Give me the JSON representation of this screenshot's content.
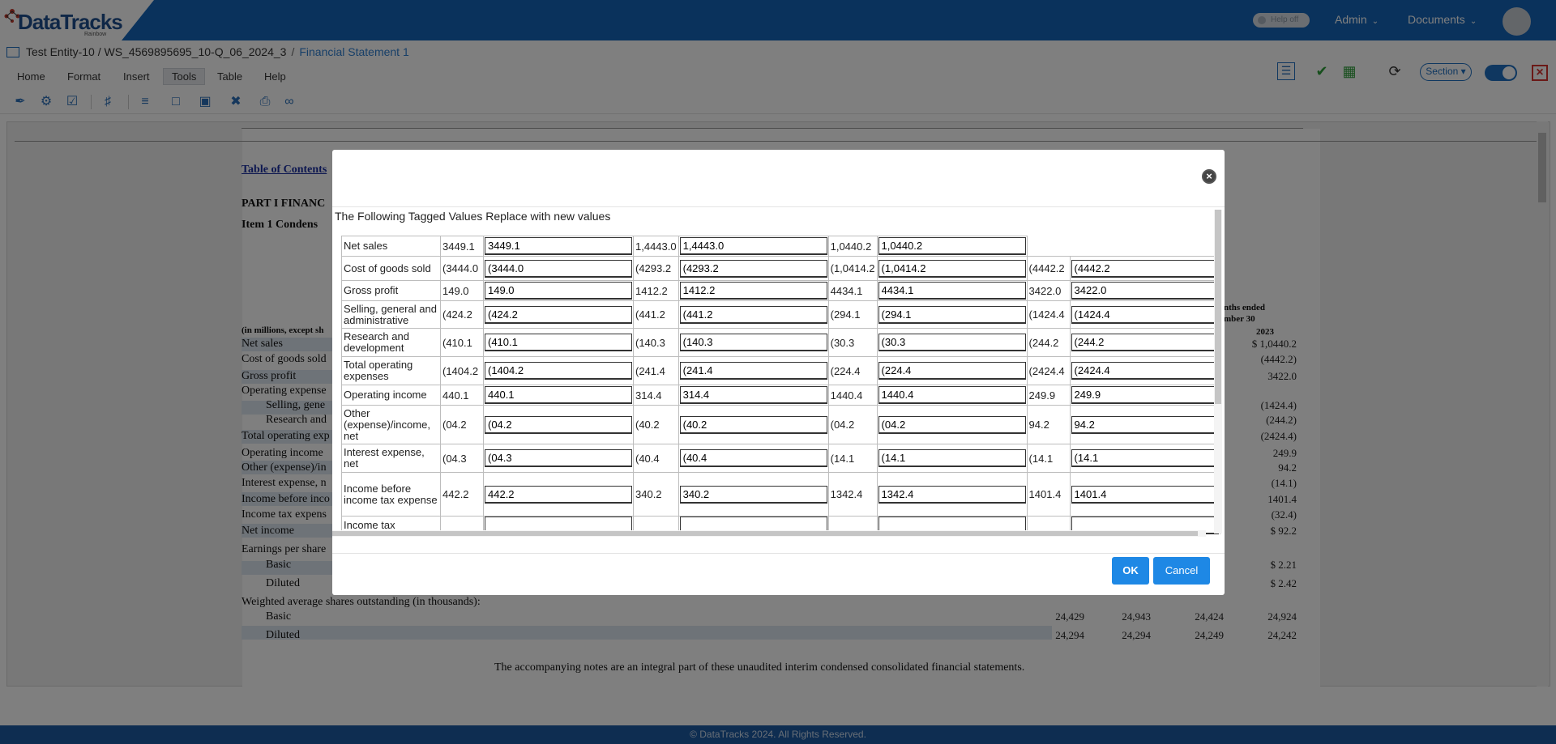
{
  "app": {
    "logo": "DataTracks",
    "logo_sub": "Rainbow",
    "help_toggle": "Help off",
    "menus": [
      "Admin",
      "Documents"
    ]
  },
  "breadcrumb": {
    "entity": "Test Entity-10 / WS_4569895695_10-Q_06_2024_3",
    "separator": "/",
    "current": "Financial Statement 1"
  },
  "menubar": [
    "Home",
    "Format",
    "Insert",
    "Tools",
    "Table",
    "Help"
  ],
  "menubar_selected": "Tools",
  "toolbar_right": {
    "section": "Section"
  },
  "document": {
    "toc_link": "Table of Contents",
    "part": "PART I    FINANC",
    "item": "Item 1    Condens",
    "units_label": "(in millions, except sh",
    "period_header": "nths ended",
    "period_header2": "mber 30",
    "year": "2023",
    "rows": [
      "Net sales",
      "Cost of goods sold",
      "Gross profit",
      "Operating expense",
      "Selling, gene",
      "Research and",
      "Total operating exp",
      "Operating income",
      "Other (expense)/in",
      "Interest expense, n",
      "Income before inco",
      "Income tax expens",
      "Net income",
      "Earnings per share",
      "Basic",
      "Diluted",
      "Weighted average shares outstanding (in thousands):",
      "Basic",
      "Diluted"
    ],
    "right_col": [
      "$ 1,0440.2",
      "(4442.2)",
      "3422.0",
      "",
      "(1424.4)",
      "(244.2)",
      "(2424.4)",
      "249.9",
      "94.2",
      "(14.1)",
      "1401.4",
      "(32.4)",
      "$ 92.2",
      "",
      "$ 2.21",
      "$ 2.42"
    ],
    "shares_basic": [
      "24,429",
      "24,943",
      "24,424",
      "24,924"
    ],
    "shares_diluted": [
      "24,294",
      "24,294",
      "24,249",
      "24,242"
    ],
    "footnote": "The accompanying notes are an integral part of these unaudited interim condensed consolidated financial statements."
  },
  "footer": "© DataTracks 2024. All Rights Reserved.",
  "modal": {
    "title": "The Following Tagged Values Replace with new values",
    "ok": "OK",
    "cancel": "Cancel",
    "rows": [
      {
        "label": "Net sales",
        "cells": [
          [
            "3449.1",
            "3449.1"
          ],
          [
            "1,4443.0",
            "1,4443.0"
          ],
          [
            "1,0440.2",
            "1,0440.2"
          ]
        ]
      },
      {
        "label": "Cost of goods sold",
        "cells": [
          [
            "(3444.0",
            "(3444.0"
          ],
          [
            "(4293.2",
            "(4293.2"
          ],
          [
            "(1,0414.2",
            "(1,0414.2"
          ],
          [
            "(4442.2",
            "(4442.2"
          ]
        ]
      },
      {
        "label": "Gross profit",
        "cells": [
          [
            "149.0",
            "149.0"
          ],
          [
            "1412.2",
            "1412.2"
          ],
          [
            "4434.1",
            "4434.1"
          ],
          [
            "3422.0",
            "3422.0"
          ]
        ]
      },
      {
        "label": "Selling, general and administrative",
        "cells": [
          [
            "(424.2",
            "(424.2"
          ],
          [
            "(441.2",
            "(441.2"
          ],
          [
            "(294.1",
            "(294.1"
          ],
          [
            "(1424.4",
            "(1424.4"
          ]
        ]
      },
      {
        "label": "Research and development",
        "cells": [
          [
            "(410.1",
            "(410.1"
          ],
          [
            "(140.3",
            "(140.3"
          ],
          [
            "(30.3",
            "(30.3"
          ],
          [
            "(244.2",
            "(244.2"
          ]
        ]
      },
      {
        "label": "Total operating expenses",
        "cells": [
          [
            "(1404.2",
            "(1404.2"
          ],
          [
            "(241.4",
            "(241.4"
          ],
          [
            "(224.4",
            "(224.4"
          ],
          [
            "(2424.4",
            "(2424.4"
          ]
        ]
      },
      {
        "label": "Operating income",
        "cells": [
          [
            "440.1",
            "440.1"
          ],
          [
            "314.4",
            "314.4"
          ],
          [
            "1440.4",
            "1440.4"
          ],
          [
            "249.9",
            "249.9"
          ]
        ]
      },
      {
        "label": "Other (expense)/income, net",
        "cells": [
          [
            "(04.2",
            "(04.2"
          ],
          [
            "(40.2",
            "(40.2"
          ],
          [
            "(04.2",
            "(04.2"
          ],
          [
            "94.2",
            "94.2"
          ]
        ]
      },
      {
        "label": "Interest expense, net",
        "cells": [
          [
            "(04.3",
            "(04.3"
          ],
          [
            "(40.4",
            "(40.4"
          ],
          [
            "(14.1",
            "(14.1"
          ],
          [
            "(14.1",
            "(14.1"
          ]
        ]
      },
      {
        "label": "Income before income tax expense",
        "cells": [
          [
            "442.2",
            "442.2"
          ],
          [
            "340.2",
            "340.2"
          ],
          [
            "1342.4",
            "1342.4"
          ],
          [
            "1401.4",
            "1401.4"
          ]
        ]
      },
      {
        "label": "Income tax",
        "cells": [
          [
            "",
            ""
          ],
          [
            "",
            ""
          ],
          [
            "",
            ""
          ],
          [
            "",
            ""
          ]
        ]
      }
    ]
  }
}
